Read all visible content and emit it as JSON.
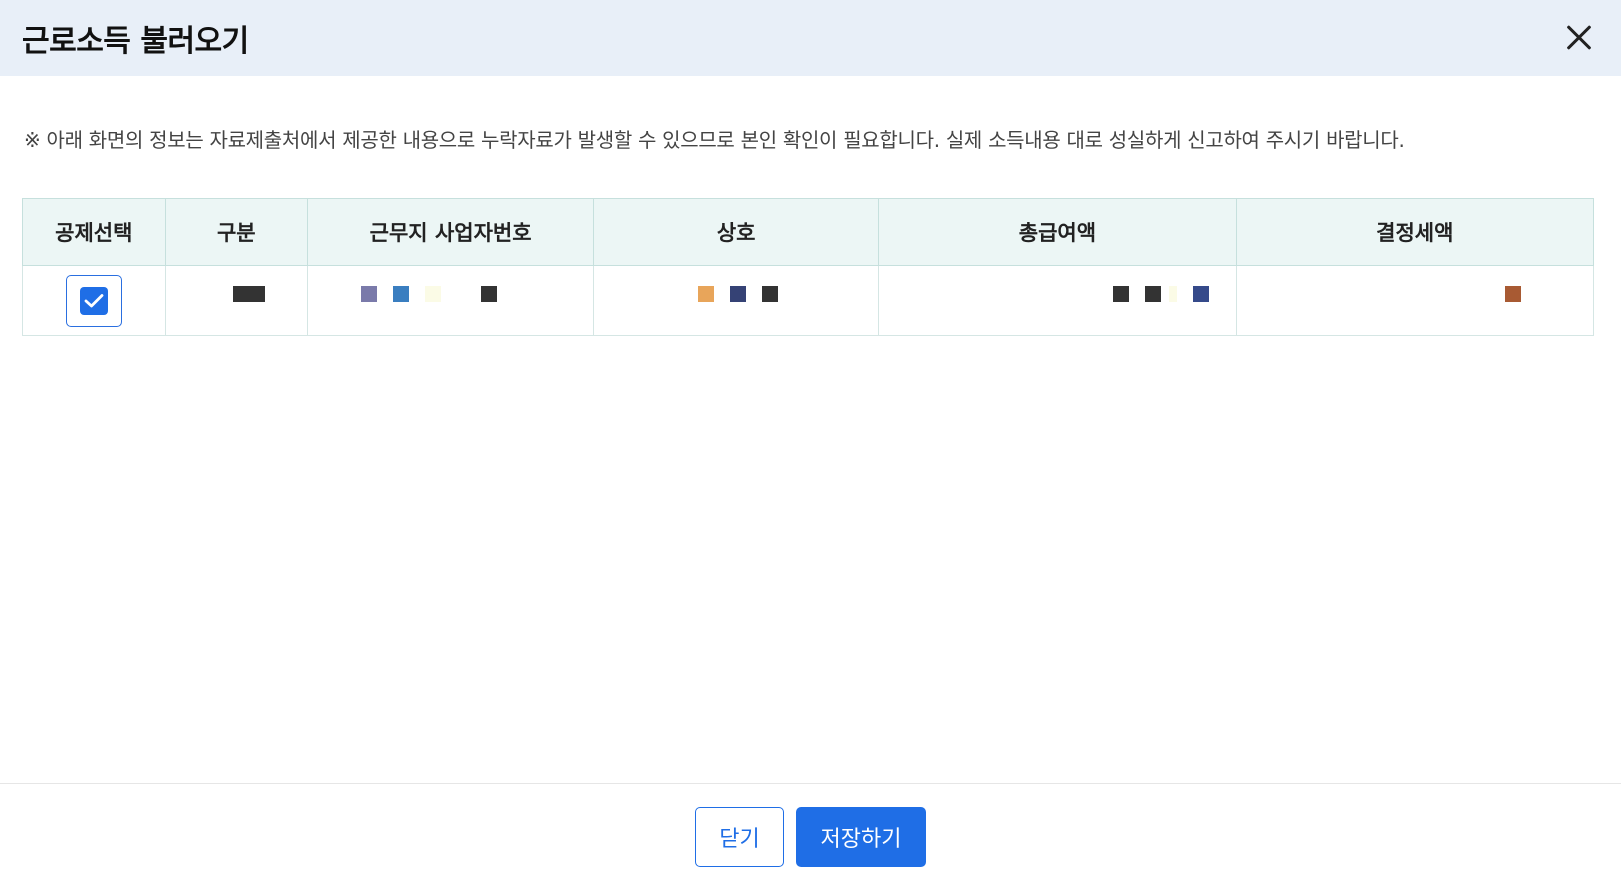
{
  "dialog": {
    "title": "근로소득 불러오기",
    "notice": "※ 아래 화면의 정보는 자료제출처에서 제공한 내용으로 누락자료가 발생할 수 있으므로 본인 확인이 필요합니다. 실제 소득내용 대로 성실하게 신고하여 주시기 바랍니다."
  },
  "table": {
    "headers": [
      "공제선택",
      "구분",
      "근무지 사업자번호",
      "상호",
      "총급여액",
      "결정세액"
    ],
    "rows": [
      {
        "selected": true,
        "redacted_colors": {
          "category": [
            "#333333"
          ],
          "business_number": [
            "#7a7aaa",
            "#3a7ec0",
            "#fbfbe6",
            "#333333"
          ],
          "company_name": [
            "#e8a55a",
            "#354275",
            "#333333"
          ],
          "total_salary": [
            "#333333",
            "#333333",
            "#fbfbe6",
            "#354a8a"
          ],
          "determined_tax": [
            "#a85a33"
          ]
        }
      }
    ]
  },
  "footer": {
    "close_label": "닫기",
    "save_label": "저장하기"
  },
  "colors": {
    "header_bg": "#e8eff8",
    "accent": "#1f6ee6",
    "table_header_bg": "#ecf6f5"
  },
  "icons": {
    "close": "close-icon",
    "checkbox": "check-icon"
  }
}
